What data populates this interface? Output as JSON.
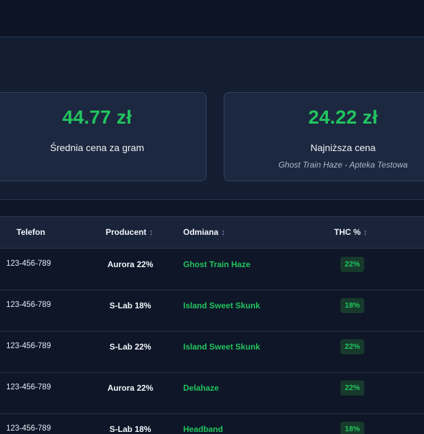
{
  "stats": {
    "avg_price": {
      "value": "44.77 zł",
      "label": "Średnia cena za gram"
    },
    "min_price": {
      "value": "24.22 zł",
      "label": "Najniższa cena",
      "sub": "Ghost Train Haze - Apteka Testowa"
    }
  },
  "table": {
    "headers": {
      "phone": "Telefon",
      "producer": "Producent",
      "strain": "Odmiana",
      "thc": "THC %",
      "sort_icon": "↕"
    },
    "rows": [
      {
        "phone": "123-456-789",
        "producer": "Aurora 22%",
        "strain": "Ghost Train Haze",
        "thc": "22%"
      },
      {
        "phone": "123-456-789",
        "producer": "S-Lab 18%",
        "strain": "Island Sweet Skunk",
        "thc": "18%"
      },
      {
        "phone": "123-456-789",
        "producer": "S-Lab 22%",
        "strain": "Island Sweet Skunk",
        "thc": "22%"
      },
      {
        "phone": "123-456-789",
        "producer": "Aurora 22%",
        "strain": "Delahaze",
        "thc": "22%"
      },
      {
        "phone": "123-456-789",
        "producer": "S-Lab 18%",
        "strain": "Headband",
        "thc": "18%"
      }
    ]
  },
  "colors": {
    "accent": "#22c55e",
    "background": "#0e1628",
    "card": "#1c2840"
  }
}
